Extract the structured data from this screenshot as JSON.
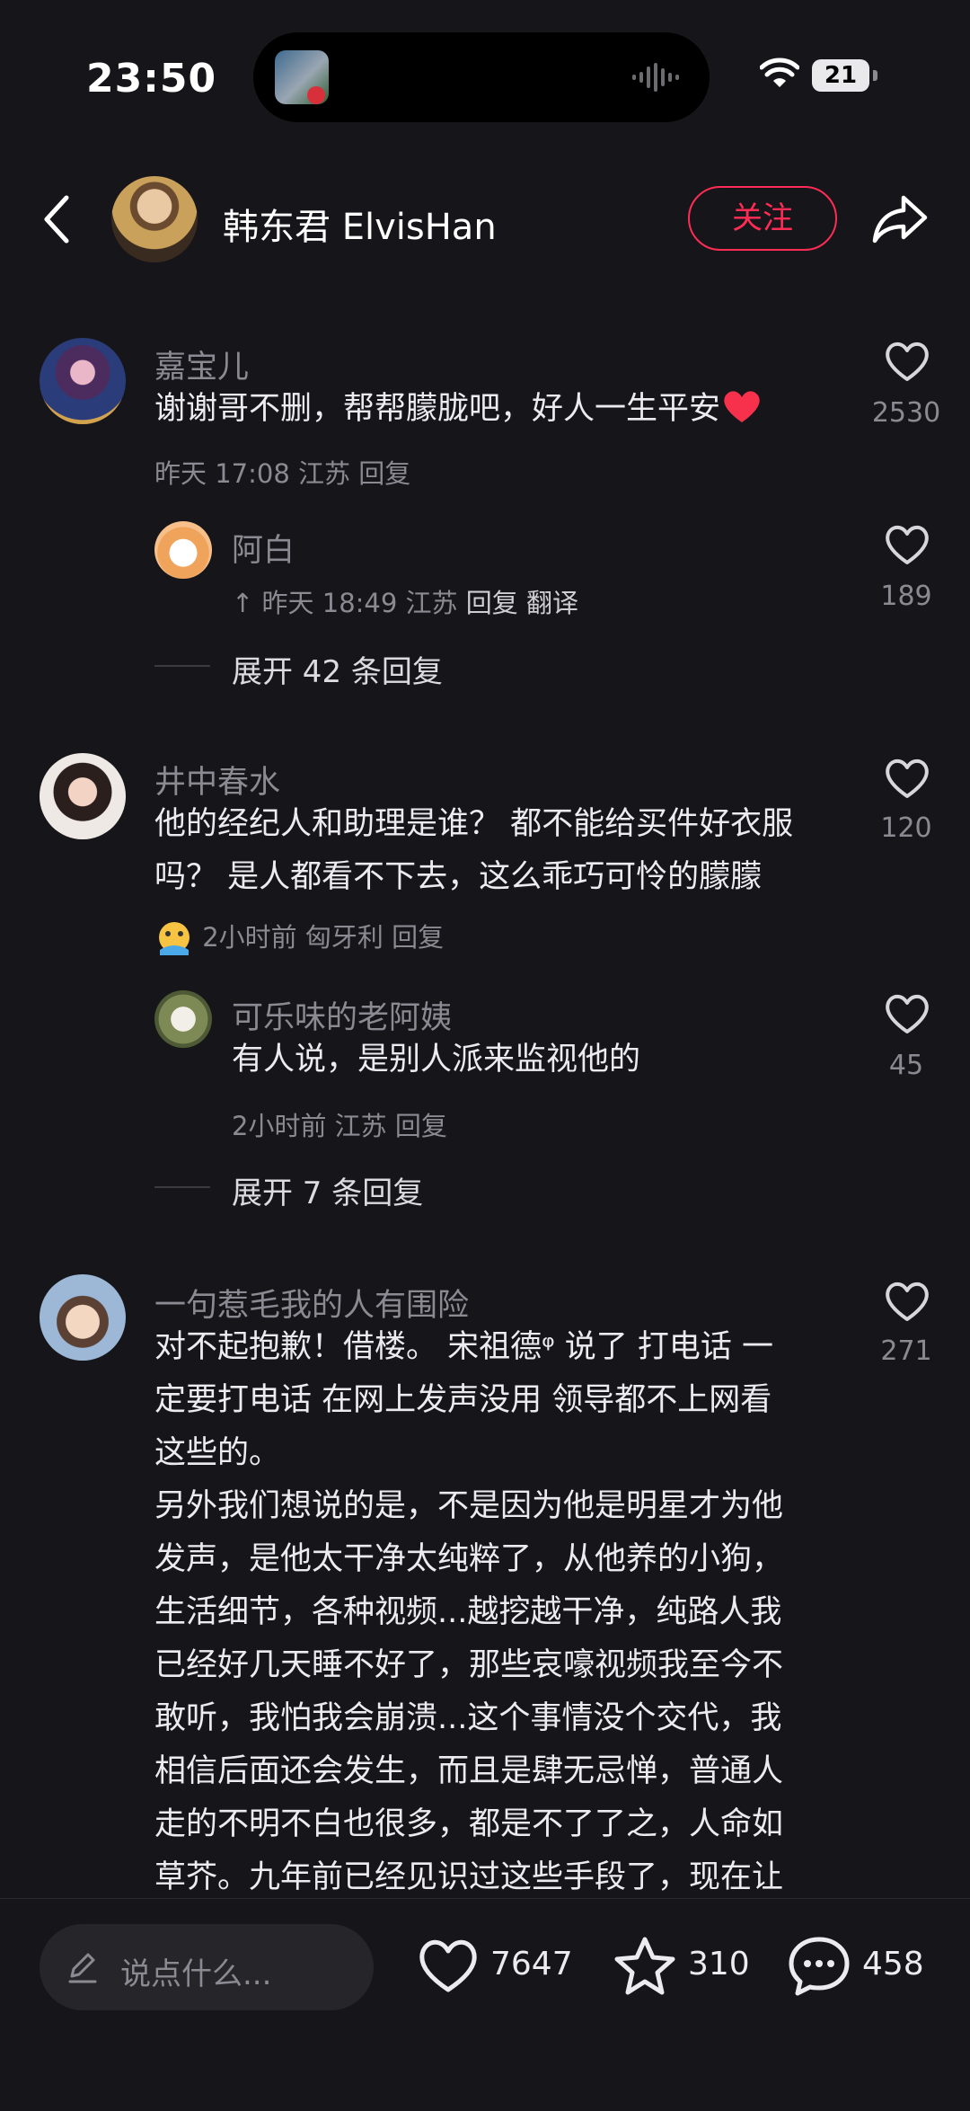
{
  "status_bar": {
    "time": "23:50",
    "battery": "21"
  },
  "header": {
    "username": "韩东君 ElvisHan",
    "follow_label": "关注"
  },
  "comments": [
    {
      "user": "嘉宝儿",
      "text": "谢谢哥不删，帮帮朦胧吧，好人一生平安",
      "time_location": "昨天 17:08 江苏",
      "reply_label": "回复",
      "likes": "2530",
      "replies": [
        {
          "user": "阿白",
          "time_location": "昨天 18:49 江苏",
          "reply_label": "回复",
          "translate_label": "翻译",
          "likes": "189"
        }
      ],
      "expand_label": "展开 42 条回复"
    },
    {
      "user": "井中春水",
      "text_lines": [
        "他的经纪人和助理是谁？ 都不能给买件好衣服",
        "吗？ 是人都看不下去，这么乖巧可怜的朦朦"
      ],
      "time_location": "2小时前 匈牙利",
      "reply_label": "回复",
      "likes": "120",
      "replies": [
        {
          "user": "可乐味的老阿姨",
          "text": "有人说，是别人派来监视他的",
          "time_location": "2小时前 江苏",
          "reply_label": "回复",
          "likes": "45"
        }
      ],
      "expand_label": "展开 7 条回复"
    },
    {
      "user": "一句惹毛我的人有围险",
      "likes": "271",
      "text_lines": [
        "对不起抱歉！借楼。 宋祖德ᵠ  说了 打电话 一",
        "定要打电话 在网上发声没用 领导都不上网看",
        "这些的。",
        "另外我们想说的是，不是因为他是明星才为他",
        "发声，是他太干净太纯粹了，从他养的小狗，",
        "生活细节，各种视频...越挖越干净，纯路人我",
        "已经好几天睡不好了，那些哀嚎视频我至今不",
        "敢听，我怕我会崩溃...这个事情没个交代，我",
        "相信后面还会发生，而且是肆无忌惮，普通人",
        "走的不明不白也很多，都是不了了之，人命如",
        "草芥。九年前已经见识过这些手段了，现在让"
      ]
    }
  ],
  "bottom_bar": {
    "input_placeholder": "说点什么...",
    "likes": "7647",
    "favorites": "310",
    "comments": "458"
  },
  "colors": {
    "accent": "#fe2c55",
    "background": "#16161a"
  }
}
